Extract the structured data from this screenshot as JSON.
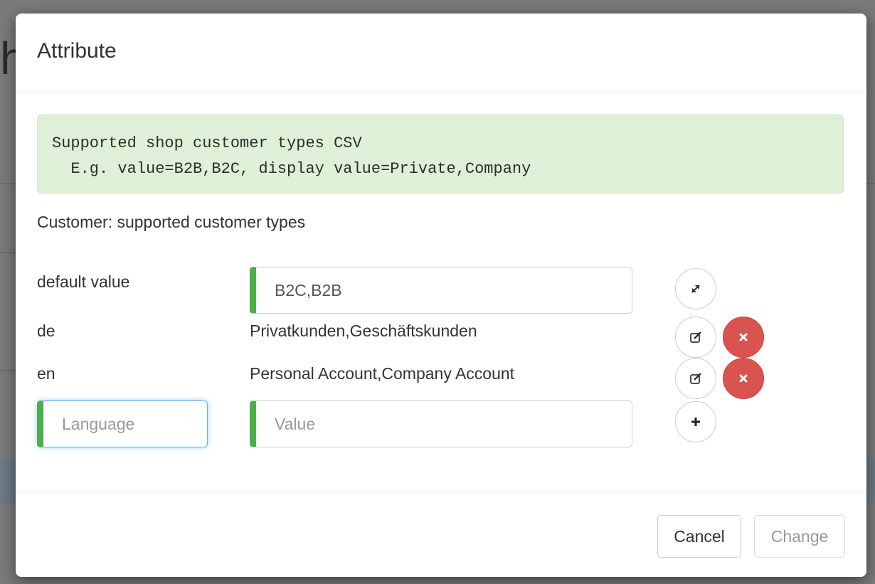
{
  "modal": {
    "title": "Attribute",
    "info_line1": "Supported shop customer types CSV",
    "info_line2": "  E.g. value=B2B,B2C, display value=Private,Company",
    "description": "Customer: supported customer types"
  },
  "rows": [
    {
      "label": "default value",
      "value": "B2C,B2B"
    },
    {
      "label": "de",
      "value": "Privatkunden,Geschäftskunden"
    },
    {
      "label": "en",
      "value": "Personal Account,Company Account"
    }
  ],
  "new_row": {
    "language_placeholder": "Language",
    "value_placeholder": "Value"
  },
  "icons": {
    "expand": "expand-icon",
    "edit": "edit-icon",
    "remove": "remove-icon",
    "add": "plus-icon"
  },
  "footer": {
    "cancel_label": "Cancel",
    "change_label": "Change"
  },
  "colors": {
    "success_border": "#4cae4c",
    "alert_bg": "#dff0d8",
    "danger": "#d9534f",
    "focus": "#66afe9"
  }
}
